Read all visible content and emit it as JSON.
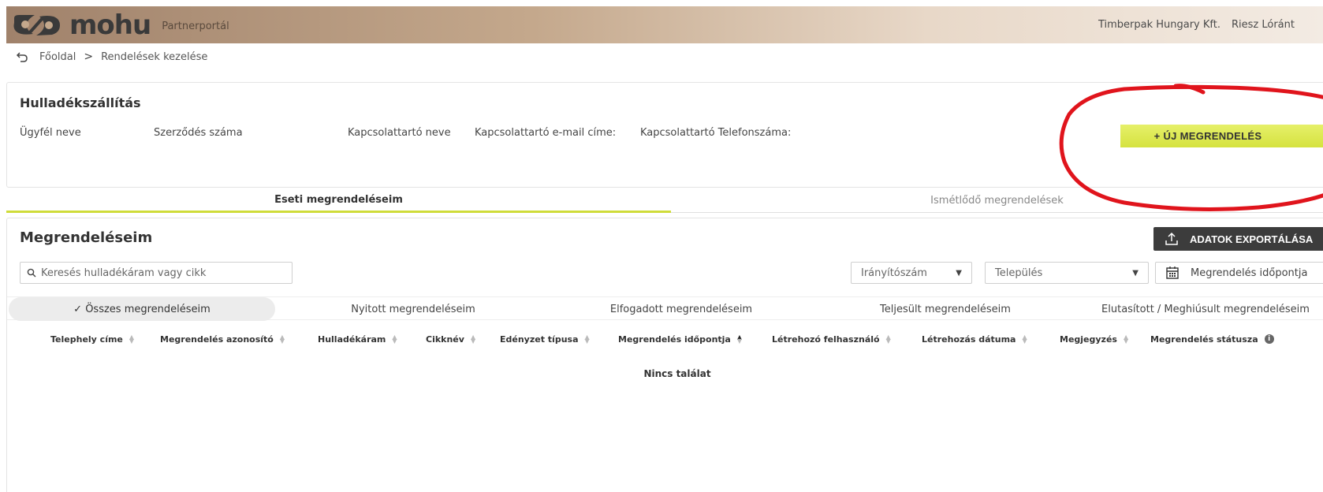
{
  "header": {
    "logo_text": "mohu",
    "portal_label": "Partnerportál",
    "company": "Timberpak Hungary Kft.",
    "user": "Riesz Lóránt"
  },
  "breadcrumb": {
    "home": "Főoldal",
    "separator": ">",
    "current": "Rendelések kezelése"
  },
  "service": {
    "title": "Hulladékszállítás",
    "fields": [
      "Ügyfél neve",
      "Szerződés száma",
      "Kapcsolattartó neve",
      "Kapcsolattartó e-mail címe:",
      "Kapcsolattartó Telefonszáma:"
    ],
    "new_order_label": "+ ÚJ MEGRENDELÉS"
  },
  "main_tabs": {
    "active": "Eseti megrendeléseim",
    "inactive": "Ismétlődő megrendelések"
  },
  "orders": {
    "title": "Megrendeléseim",
    "export_label": "ADATOK EXPORTÁLÁSA",
    "search_placeholder": "Keresés hulladékáram vagy cikk",
    "zip_placeholder": "Irányítószám",
    "city_placeholder": "Település",
    "date_label": "Megrendelés időpontja",
    "status_tabs": [
      "✓ Összes megrendeléseim",
      "Nyitott megrendeléseim",
      "Elfogadott megrendeléseim",
      "Teljesült megrendeléseim",
      "Elutasított / Meghiúsult megrendeléseim"
    ],
    "columns": [
      "Telephely címe",
      "Megrendelés azonosító",
      "Hulladékáram",
      "Cikknév",
      "Edényzet típusa",
      "Megrendelés időpontja",
      "Létrehozó felhasználó",
      "Létrehozás dátuma",
      "Megjegyzés",
      "Megrendelés státusza"
    ],
    "sorted_column": "Megrendelés időpontja",
    "empty_text": "Nincs találat"
  },
  "colors": {
    "accent": "#d5e23f",
    "annotation": "#e0141c",
    "dark_button": "#3c3c3c"
  }
}
